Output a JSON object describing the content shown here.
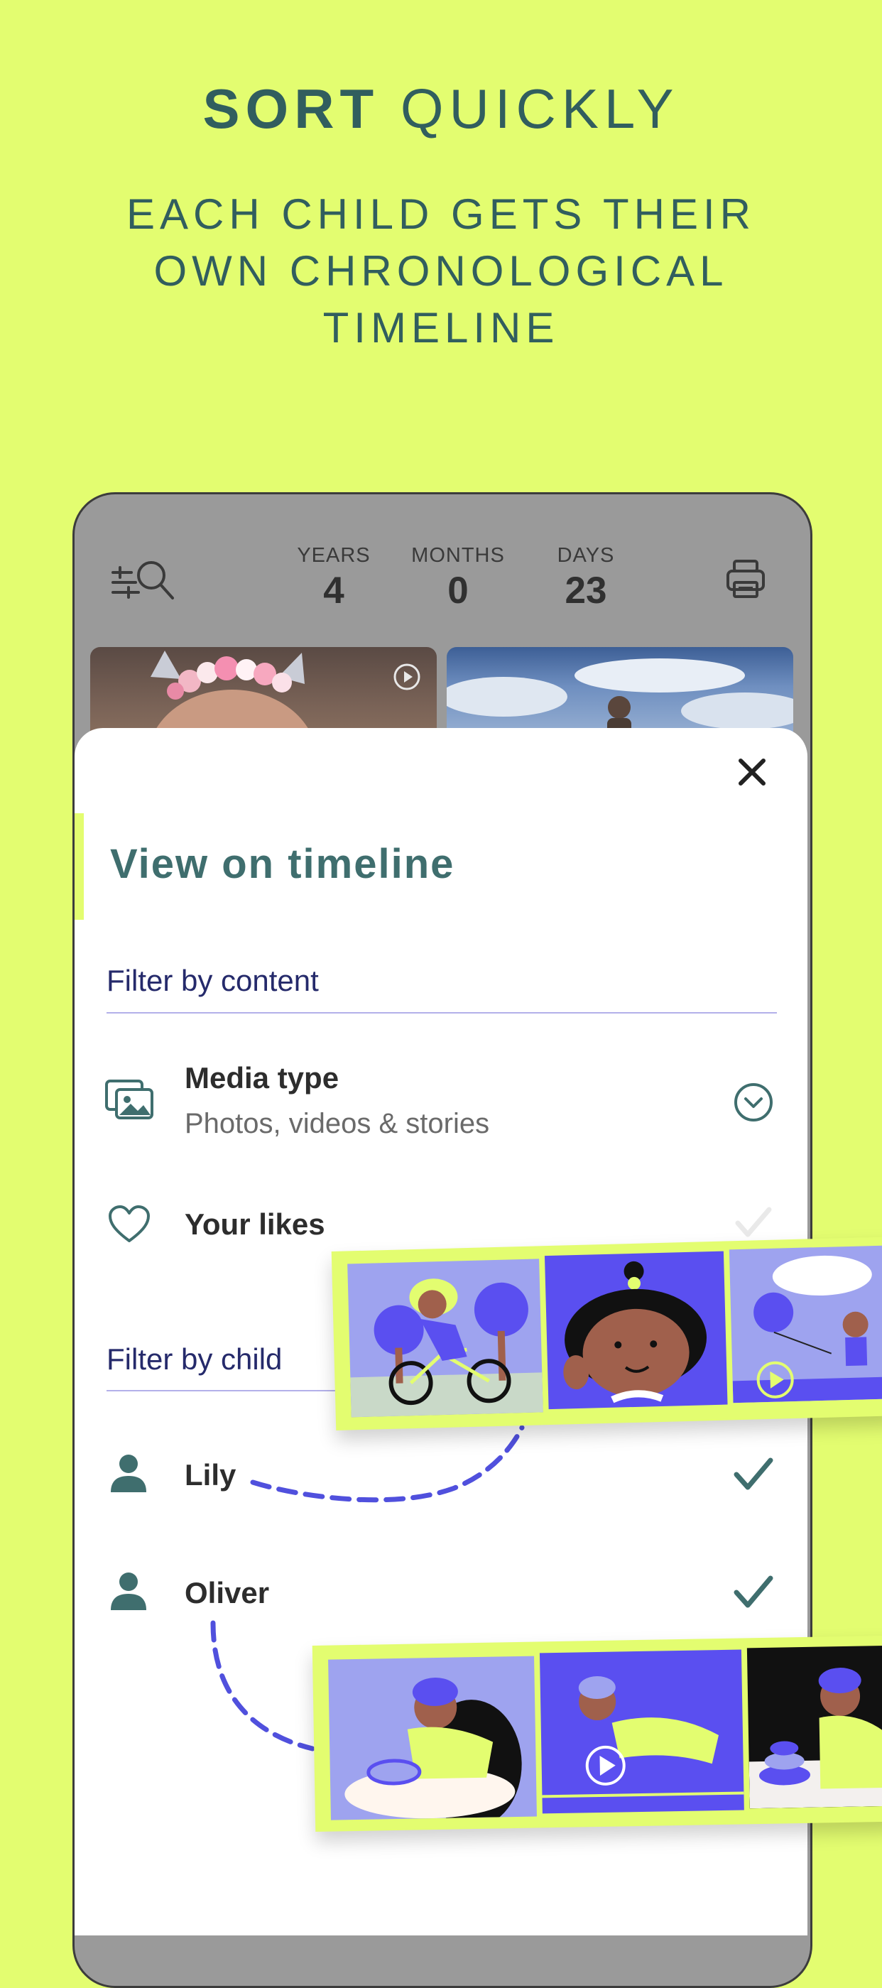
{
  "promo": {
    "headline_bold": "SORT",
    "headline_light": "QUICKLY",
    "subheadline_lines": [
      "EACH CHILD GETS THEIR",
      "OWN CHRONOLOGICAL",
      "TIMELINE"
    ]
  },
  "age_counter": {
    "years_label": "YEARS",
    "years_value": "4",
    "months_label": "MONTHS",
    "months_value": "0",
    "days_label": "DAYS",
    "days_value": "23"
  },
  "sheet": {
    "title": "View on timeline",
    "filter_content_label": "Filter by content",
    "media_type": {
      "title": "Media type",
      "subtitle": "Photos, videos & stories"
    },
    "likes": {
      "title": "Your likes",
      "checked": false
    },
    "filter_child_label": "Filter by child",
    "children": [
      {
        "name": "Lily",
        "checked": true
      },
      {
        "name": "Oliver",
        "checked": true
      }
    ]
  },
  "colors": {
    "background": "#e3fd70",
    "text_primary": "#315e5e",
    "section_label": "#252a6b",
    "divider": "#b3b0ea",
    "check": "#3f6e6e",
    "connector": "#5050dd",
    "illustration_blue": "#5a4ff0"
  },
  "icons": {
    "header_left": "filter-search-icon",
    "header_right": "print-icon",
    "close": "close-icon",
    "media": "photos-icon",
    "expand": "chevron-down-circle-icon",
    "likes": "heart-icon",
    "child": "person-icon",
    "selected": "checkmark-icon"
  }
}
